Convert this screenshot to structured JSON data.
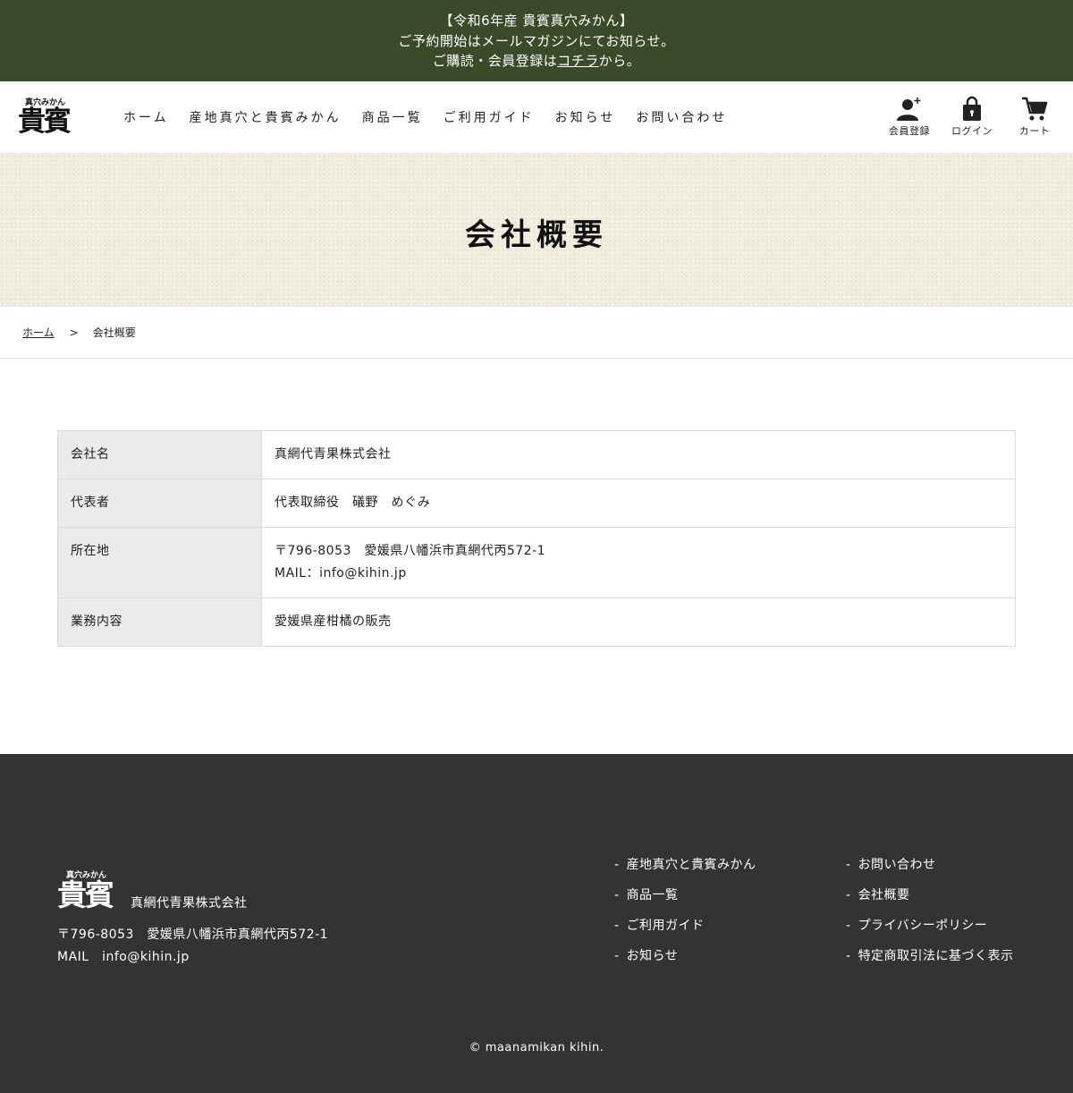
{
  "announcement": {
    "line1": "【令和6年産 貴賓真穴みかん】",
    "line2": "ご予約開始はメールマガジンにてお知らせ。",
    "line3_prefix": "ご購読・会員登録は",
    "line3_link": "コチラ",
    "line3_suffix": "から。"
  },
  "header": {
    "logo_ruby": "真穴みかん",
    "logo_main": "貴賓",
    "nav": [
      "ホーム",
      "産地真穴と貴賓みかん",
      "商品一覧",
      "ご利用ガイド",
      "お知らせ",
      "お問い合わせ"
    ],
    "icons": [
      {
        "label": "会員登録",
        "icon": "user-plus-icon"
      },
      {
        "label": "ログイン",
        "icon": "lock-bag-icon"
      },
      {
        "label": "カート",
        "icon": "cart-icon"
      }
    ]
  },
  "hero": {
    "title": "会社概要"
  },
  "breadcrumb": {
    "home": "ホーム",
    "separator": ">",
    "current": "会社概要"
  },
  "company_table": {
    "rows": [
      {
        "label": "会社名",
        "value": "真網代青果株式会社"
      },
      {
        "label": "代表者",
        "value": "代表取締役　礒野　めぐみ"
      },
      {
        "label": "所在地",
        "value": "〒796-8053　愛媛県八幡浜市真網代丙572-1",
        "value2": "MAIL：info@kihin.jp"
      },
      {
        "label": "業務内容",
        "value": "愛媛県産柑橘の販売"
      }
    ]
  },
  "footer": {
    "logo_ruby": "真穴みかん",
    "logo_main": "貴賓",
    "company": "真網代青果株式会社",
    "address": "〒796-8053　愛媛県八幡浜市真網代丙572-1",
    "mail": "MAIL　info@kihin.jp",
    "links_col1": [
      "産地真穴と貴賓みかん",
      "商品一覧",
      "ご利用ガイド",
      "お知らせ"
    ],
    "links_col2": [
      "お問い合わせ",
      "会社概要",
      "プライバシーポリシー",
      "特定商取引法に基づく表示"
    ],
    "copyright": "© maanamikan kihin."
  },
  "colors": {
    "announcement_bg": "#3b4a28",
    "footer_bg": "#333333",
    "table_header_bg": "#ebebeb",
    "hero_bg": "#f1eee0"
  }
}
